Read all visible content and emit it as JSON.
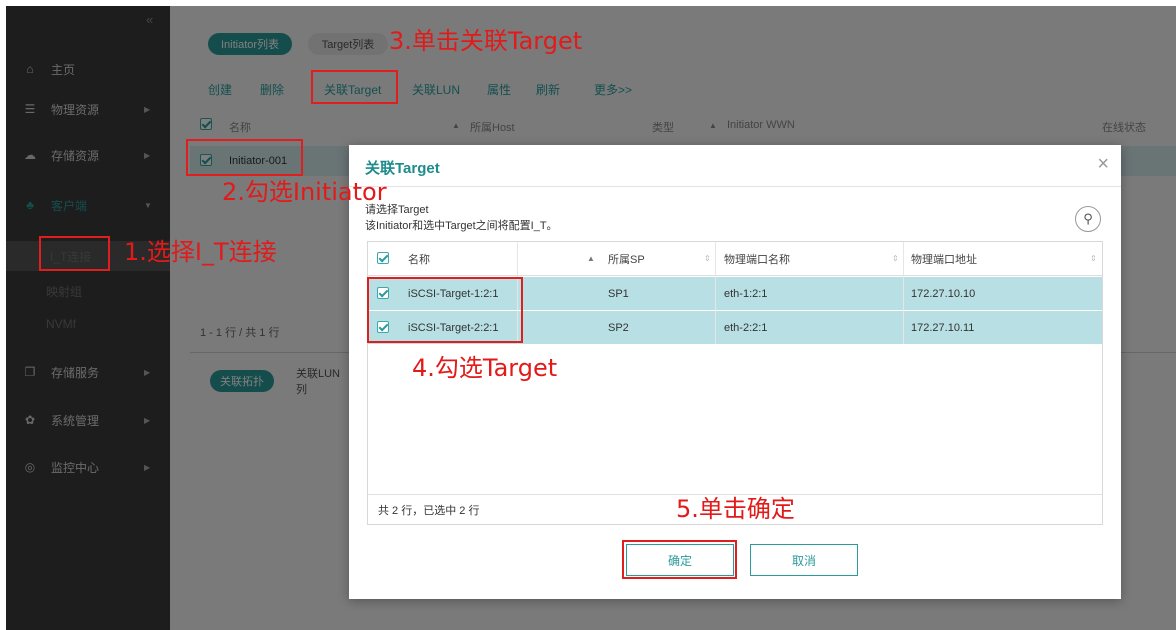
{
  "sidebar": {
    "collapse_symbol": "«",
    "items": [
      {
        "label": "主页",
        "icon": "home-icon",
        "glyph": "⌂"
      },
      {
        "label": "物理资源",
        "icon": "list-icon",
        "glyph": "☰"
      },
      {
        "label": "存储资源",
        "icon": "cloud-icon",
        "glyph": "☁"
      },
      {
        "label": "客户端",
        "icon": "hierarchy-icon",
        "glyph": "♣"
      },
      {
        "label": "存储服务",
        "icon": "copy-icon",
        "glyph": "❐"
      },
      {
        "label": "系统管理",
        "icon": "gear-icon",
        "glyph": "✿"
      },
      {
        "label": "监控中心",
        "icon": "gauge-icon",
        "glyph": "◎"
      }
    ],
    "sub_items": [
      "I_T连接",
      "映射组",
      "NVMf"
    ]
  },
  "top_tabs": [
    "Initiator列表",
    "Target列表"
  ],
  "toolbar": [
    "创建",
    "删除",
    "关联Target",
    "关联LUN",
    "属性",
    "刷新",
    "更多>>"
  ],
  "table": {
    "headers": [
      "名称",
      "所属Host",
      "类型",
      "Initiator WWN",
      "在线状态"
    ],
    "rows": [
      {
        "name": "Initiator-001"
      }
    ],
    "pagination": "1 - 1 行 / 共 1 行"
  },
  "bottom_tabs": [
    "关联拓扑",
    "关联LUN列"
  ],
  "dialog": {
    "title": "关联Target",
    "note_line1": "请选择Target",
    "note_line2": "该Initiator和选中Target之间将配置I_T。",
    "columns": [
      "名称",
      "所属SP",
      "物理端口名称",
      "物理端口地址"
    ],
    "rows": [
      {
        "name": "iSCSI-Target-1:2:1",
        "sp": "SP1",
        "port_name": "eth-1:2:1",
        "port_addr": "172.27.10.10"
      },
      {
        "name": "iSCSI-Target-2:2:1",
        "sp": "SP2",
        "port_name": "eth-2:2:1",
        "port_addr": "172.27.10.11"
      }
    ],
    "count_text": "共 2 行，已选中 2 行",
    "ok_label": "确定",
    "cancel_label": "取消"
  },
  "annotations": {
    "step1": "1.选择I_T连接",
    "step2": "2.勾选Initiator",
    "step3": "3.单击关联Target",
    "step4": "4.勾选Target",
    "step5": "5.单击确定"
  },
  "colors": {
    "accent": "#2a9a9a",
    "annotation": "#e01e1e",
    "selected_row": "#b8e0e4"
  }
}
